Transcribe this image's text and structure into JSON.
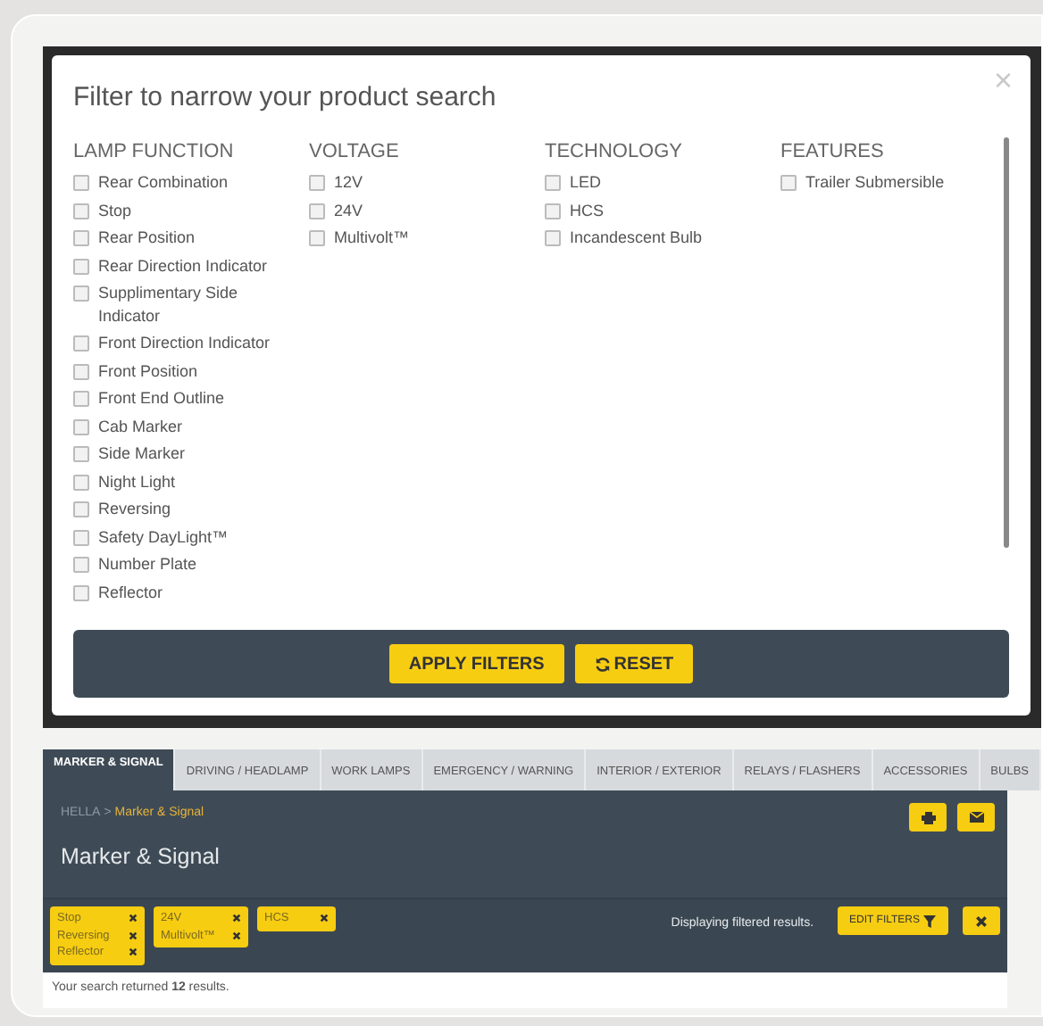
{
  "filter_modal": {
    "title": "Filter to narrow your product search",
    "close": "×",
    "groups": [
      {
        "heading": "LAMP FUNCTION",
        "options": [
          {
            "label": "Rear Combination",
            "checked": false
          },
          {
            "label": "Stop",
            "checked": false
          },
          {
            "label": "Rear Position",
            "checked": false
          },
          {
            "label": "Rear Direction Indicator",
            "checked": false
          },
          {
            "label": "Supplimentary Side Indicator",
            "checked": false
          },
          {
            "label": "Front Direction Indicator",
            "checked": false
          },
          {
            "label": "Front Position",
            "checked": false
          },
          {
            "label": "Front End Outline",
            "checked": false
          },
          {
            "label": "Cab Marker",
            "checked": false
          },
          {
            "label": "Side Marker",
            "checked": false
          },
          {
            "label": "Night Light",
            "checked": false
          },
          {
            "label": "Reversing",
            "checked": false
          },
          {
            "label": "Safety DayLight™",
            "checked": false
          },
          {
            "label": "Number Plate",
            "checked": false
          },
          {
            "label": "Reflector",
            "checked": false
          }
        ]
      },
      {
        "heading": "VOLTAGE",
        "options": [
          {
            "label": "12V",
            "checked": false
          },
          {
            "label": "24V",
            "checked": false
          },
          {
            "label": "Multivolt™",
            "checked": false
          }
        ]
      },
      {
        "heading": "TECHNOLOGY",
        "options": [
          {
            "label": "LED",
            "checked": false
          },
          {
            "label": "HCS",
            "checked": false
          },
          {
            "label": "Incandescent Bulb",
            "checked": false
          }
        ]
      },
      {
        "heading": "FEATURES",
        "options": [
          {
            "label": "Trailer Submersible",
            "checked": false
          }
        ]
      }
    ],
    "buttons": [
      {
        "label": "APPLY FILTERS",
        "kind": "apply"
      },
      {
        "label": "RESET",
        "kind": "reset"
      }
    ]
  },
  "tabs": [
    {
      "label": "MARKER & SIGNAL",
      "selected": true
    },
    {
      "label": "DRIVING / HEADLAMP",
      "selected": false
    },
    {
      "label": "WORK LAMPS",
      "selected": false
    },
    {
      "label": "EMERGENCY / WARNING",
      "selected": false
    },
    {
      "label": "INTERIOR / EXTERIOR",
      "selected": false
    },
    {
      "label": "RELAYS / FLASHERS",
      "selected": false
    },
    {
      "label": "ACCESSORIES",
      "selected": false
    },
    {
      "label": "BULBS",
      "selected": false
    }
  ],
  "breadcrumb": [
    {
      "label": "HELLA",
      "current": false
    },
    {
      "label": "Marker & Signal",
      "current": true
    }
  ],
  "breadcrumb_separator": ">",
  "page_title": "Marker & Signal",
  "filter_chips": [
    {
      "items": [
        "Stop",
        "Reversing",
        "Reflector"
      ]
    },
    {
      "items": [
        "24V",
        "Multivolt™"
      ]
    },
    {
      "items": [
        "HCS"
      ]
    }
  ],
  "filter_status": "Displaying filtered results.",
  "edit_filters_button": "EDIT FILTERS",
  "results_text": "Your search returned **12** results."
}
